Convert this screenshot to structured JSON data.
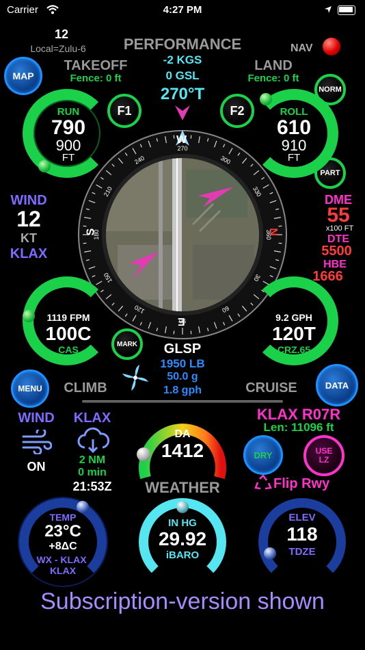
{
  "status": {
    "carrier": "Carrier",
    "time": "4:27 PM"
  },
  "header": {
    "day": "12",
    "timezone": "Local=Zulu-6",
    "title": "PERFORMANCE",
    "nav": "NAV"
  },
  "takeoff": {
    "title": "TAKEOFF",
    "fence": "Fence: 0 ft",
    "label": "RUN",
    "value": "790",
    "sub": "900",
    "unit": "FT",
    "button": "F1"
  },
  "land": {
    "title": "LAND",
    "fence": "Fence: 0 ft",
    "label": "ROLL",
    "value": "610",
    "sub": "910",
    "unit": "FT",
    "button": "F2"
  },
  "center": {
    "kgs": "-2 KGS",
    "gsl": "0 GSL",
    "heading": "270°T"
  },
  "buttons": {
    "map": "MAP",
    "norm": "NORM",
    "part": "PART",
    "mark": "MARK",
    "menu": "MENU",
    "data": "DATA"
  },
  "compass": {
    "cardinals": {
      "north": "N",
      "east": "E",
      "south": "S",
      "west": "W"
    },
    "ticks": [
      "30",
      "60",
      "90",
      "120",
      "150",
      "180",
      "210",
      "240",
      "270",
      "300",
      "330",
      "360"
    ]
  },
  "wind": {
    "title": "WIND",
    "value": "12",
    "unit": "KT",
    "airport": "KLAX"
  },
  "dme": {
    "title": "DME",
    "value": "55",
    "unit": "x100 FT",
    "dte_label": "DTE",
    "dte_value": "5500",
    "hbe_label": "HBE",
    "hbe_value": "1666"
  },
  "climb": {
    "top": "1119 FPM",
    "value": "100C",
    "label": "CAS",
    "title": "CLIMB"
  },
  "cruise": {
    "top": "9.2 GPH",
    "value": "120T",
    "label": "CRZ.65",
    "title": "CRUISE"
  },
  "glsp": {
    "title": "GLSP",
    "weight": "1950 LB",
    "fuel_g": "50.0 g",
    "fuel_rate": "1.8 gph"
  },
  "weather": {
    "wind_label": "WIND",
    "wind_state": "ON",
    "station": "KLAX",
    "distance": "2 NM",
    "age": "0 min",
    "zulu": "21:53Z",
    "da_label": "DA",
    "da_value": "1412",
    "title": "WEATHER"
  },
  "runway": {
    "name": "KLAX R07R",
    "length": "Len: 11096 ft",
    "dry": "DRY",
    "use_lz_1": "USE",
    "use_lz_2": "LZ",
    "flip": "Flip Rwy"
  },
  "temp": {
    "label": "TEMP",
    "value": "23°C",
    "delta": "+8ΔC",
    "source": "WX - KLAX",
    "station": "KLAX"
  },
  "baro": {
    "label": "IN HG",
    "value": "29.92",
    "sub": "iBARO"
  },
  "elev": {
    "label": "ELEV",
    "value": "118",
    "sub": "TDZE"
  },
  "footer": {
    "text": "Subscription-version shown"
  },
  "colors": {
    "green": "#1bd14a",
    "cyan": "#55e6f2",
    "purple": "#7f6bff",
    "magenta": "#ff33cc",
    "red": "#ff3b3b",
    "blue": "#2a8cff"
  }
}
